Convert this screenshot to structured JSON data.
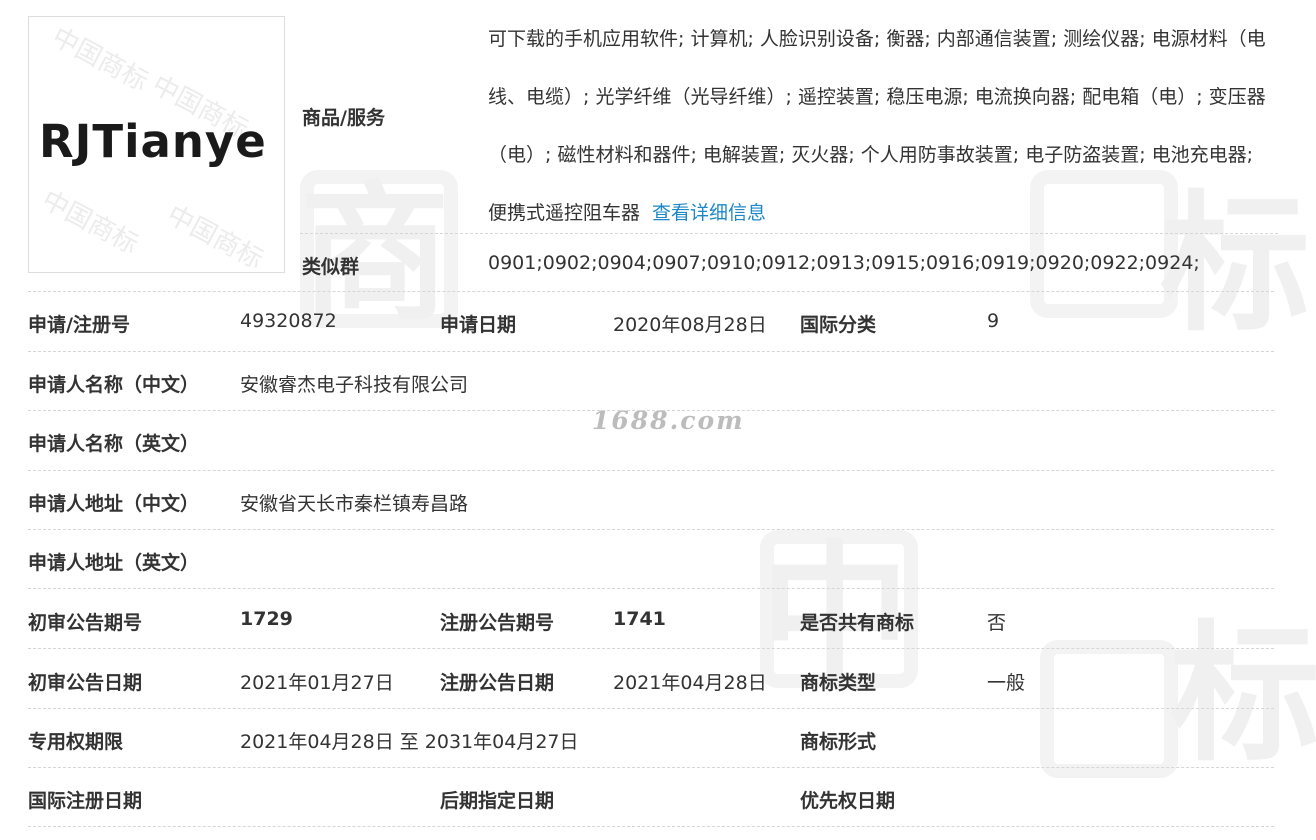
{
  "logo": {
    "text": "RJTianye",
    "watermark": "中国商标"
  },
  "watermark_site": "1688.com",
  "watermark_chars": [
    "商",
    "标",
    "中"
  ],
  "goods": {
    "label": "商品/服务",
    "text": "可下载的手机应用软件; 计算机; 人脸识别设备; 衡器; 内部通信装置; 测绘仪器; 电源材料（电线、电缆）; 光学纤维（光导纤维）; 遥控装置; 稳压电源; 电流换向器; 配电箱（电）; 变压器（电）; 磁性材料和器件; 电解装置; 灭火器; 个人用防事故装置; 电子防盗装置; 电池充电器; 便携式遥控阻车器",
    "detail_link": "查看详细信息"
  },
  "similar": {
    "label": "类似群",
    "value": "0901;0902;0904;0907;0910;0912;0913;0915;0916;0919;0920;0922;0924;"
  },
  "fields": {
    "reg_no_label": "申请/注册号",
    "reg_no": "49320872",
    "app_date_label": "申请日期",
    "app_date": "2020年08月28日",
    "intl_class_label": "国际分类",
    "intl_class": "9",
    "applicant_cn_label": "申请人名称（中文）",
    "applicant_cn": "安徽睿杰电子科技有限公司",
    "applicant_en_label": "申请人名称（英文）",
    "applicant_en": "",
    "address_cn_label": "申请人地址（中文）",
    "address_cn": "安徽省天长市秦栏镇寿昌路",
    "address_en_label": "申请人地址（英文）",
    "address_en": "",
    "prelim_no_label": "初审公告期号",
    "prelim_no": "1729",
    "reg_notice_no_label": "注册公告期号",
    "reg_notice_no": "1741",
    "shared_label": "是否共有商标",
    "shared": "否",
    "prelim_date_label": "初审公告日期",
    "prelim_date": "2021年01月27日",
    "reg_notice_date_label": "注册公告日期",
    "reg_notice_date": "2021年04月28日",
    "tm_type_label": "商标类型",
    "tm_type": "一般",
    "exclusive_label": "专用权期限",
    "exclusive": "2021年04月28日 至 2031年04月27日",
    "tm_form_label": "商标形式",
    "tm_form": "",
    "intl_reg_date_label": "国际注册日期",
    "intl_reg_date": "",
    "later_date_label": "后期指定日期",
    "later_date": "",
    "priority_label": "优先权日期",
    "priority": ""
  }
}
